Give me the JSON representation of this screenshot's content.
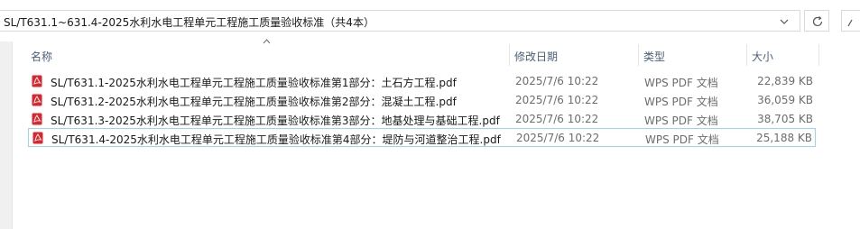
{
  "address": {
    "path": "SL/T631.1~631.4-2025水利水电工程单元工程施工质量验收标准（共4本）"
  },
  "columns": {
    "name": "名称",
    "date": "修改日期",
    "type": "类型",
    "size": "大小"
  },
  "files": [
    {
      "name": "SL/T631.1-2025水利水电工程单元工程施工质量验收标准第1部分：土石方工程.pdf",
      "date": "2025/7/6 10:22",
      "type": "WPS PDF 文档",
      "size": "22,839 KB",
      "icon": "pdf-file-icon"
    },
    {
      "name": "SL/T631.2-2025水利水电工程单元工程施工质量验收标准第2部分：混凝土工程.pdf",
      "date": "2025/7/6 10:22",
      "type": "WPS PDF 文档",
      "size": "36,059 KB",
      "icon": "pdf-file-icon"
    },
    {
      "name": "SL/T631.3-2025水利水电工程单元工程施工质量验收标准第3部分：地基处理与基础工程.pdf",
      "date": "2025/7/6 10:22",
      "type": "WPS PDF 文档",
      "size": "38,705 KB",
      "icon": "pdf-file-icon"
    },
    {
      "name": "SL/T631.4-2025水利水电工程单元工程施工质量验收标准第4部分：堤防与河道整治工程.pdf",
      "date": "2025/7/6 10:22",
      "type": "WPS PDF 文档",
      "size": "25,188 KB",
      "icon": "pdf-file-icon"
    }
  ],
  "colors": {
    "header_text": "#4c607a",
    "selection_border": "#99d1ff",
    "pdf_icon": "#d9262c"
  }
}
